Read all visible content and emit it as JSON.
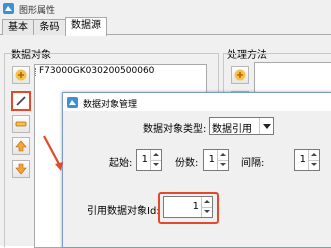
{
  "window": {
    "title": "图形属性",
    "icon": "app-icon"
  },
  "tabs": [
    {
      "label": "基本",
      "active": false
    },
    {
      "label": "条码",
      "active": false
    },
    {
      "label": "数据源",
      "active": true
    }
  ],
  "data_objects": {
    "group_label": "数据对象",
    "items": [
      "F73000GK030200500060"
    ],
    "toolbar_icons": [
      "add-icon",
      "edit-icon",
      "remove-icon",
      "move-up-icon",
      "move-down-icon"
    ]
  },
  "methods": {
    "group_label": "处理方法",
    "toolbar_icons": [
      "add-icon",
      "edit-icon"
    ]
  },
  "dialog": {
    "title": "数据对象管理",
    "type_label": "数据对象类型:",
    "type_value": "数据引用",
    "start_label": "起始:",
    "start_value": "1",
    "digits_label": "份数:",
    "digits_value": "1",
    "interval_label": "间隔:",
    "interval_value": "1",
    "ref_label": "引用数据对象Id:",
    "ref_value": "1"
  },
  "colors": {
    "highlight": "#e24a2b",
    "dialog_border": "#7a9cc7"
  }
}
